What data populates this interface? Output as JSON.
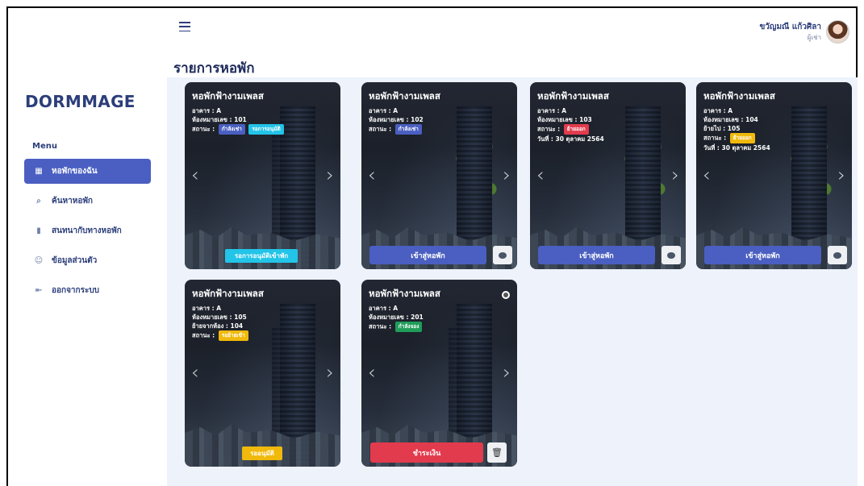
{
  "sidebar": {
    "logo": "DORMMAGE",
    "menu_title": "Menu",
    "items": [
      {
        "label": "หอพักของฉัน",
        "icon": "grid-icon",
        "active": true
      },
      {
        "label": "ค้นหาหอพัก",
        "icon": "search-icon",
        "active": false
      },
      {
        "label": "สนทนากับทางหอพัก",
        "icon": "chat-icon",
        "active": false
      },
      {
        "label": "ข้อมูลส่วนตัว",
        "icon": "user-icon",
        "active": false
      },
      {
        "label": "ออกจากระบบ",
        "icon": "logout-icon",
        "active": false
      }
    ]
  },
  "header": {
    "user_name": "ขวัญมณี แก้วศิลา",
    "user_role": "ผู้เช่า",
    "page_title": "รายการหอพัก"
  },
  "cards": [
    {
      "title": "หอพักฟ้างามเพลส",
      "building": "อาคาร : A",
      "room": "ห้องหมายเลข : 101",
      "status_label": "สถานะ :",
      "badges": [
        "กำลังเช่า",
        "รอการอนุมัติ"
      ],
      "action": "รอการอนุมัติเข้าพัก"
    },
    {
      "title": "หอพักฟ้างามเพลส",
      "building": "อาคาร : A",
      "room": "ห้องหมายเลข : 102",
      "status_label": "สถานะ :",
      "badges": [
        "กำลังเช่า"
      ],
      "action": "เข้าสู่หอพัก"
    },
    {
      "title": "หอพักฟ้างามเพลส",
      "building": "อาคาร : A",
      "room": "ห้องหมายเลข : 103",
      "status_label": "สถานะ :",
      "badges": [
        "ย้ายออก"
      ],
      "date": "วันที่ : 30 ตุลาคม 2564",
      "action": "เข้าสู่หอพัก"
    },
    {
      "title": "หอพักฟ้างามเพลส",
      "building": "อาคาร : A",
      "room": "ห้องหมายเลข : 104",
      "moved_to": "ย้ายไป : 105",
      "status_label": "สถานะ :",
      "badges": [
        "ย้ายออก"
      ],
      "date": "วันที่ : 30 ตุลาคม 2564",
      "action": "เข้าสู่หอพัก"
    },
    {
      "title": "หอพักฟ้างามเพลส",
      "building": "อาคาร : A",
      "room": "ห้องหมายเลข : 105",
      "moved_from": "ย้ายจากห้อง : 104",
      "status_label": "สถานะ :",
      "badges": [
        "รอย้ายเข้า"
      ],
      "action": "รออนุมัติ"
    },
    {
      "title": "หอพักฟ้างามเพลส",
      "building": "อาคาร : A",
      "room": "ห้องหมายเลข : 201",
      "status_label": "สถานะ :",
      "badges": [
        "กำลังจอง"
      ],
      "action": "ชำระเงิน"
    }
  ],
  "colors": {
    "primary": "#4a5fc1",
    "danger": "#e23b4d",
    "warning": "#f0b90b",
    "success": "#1f9d59",
    "info": "#22c4e8",
    "content_bg": "#eef2fb"
  }
}
